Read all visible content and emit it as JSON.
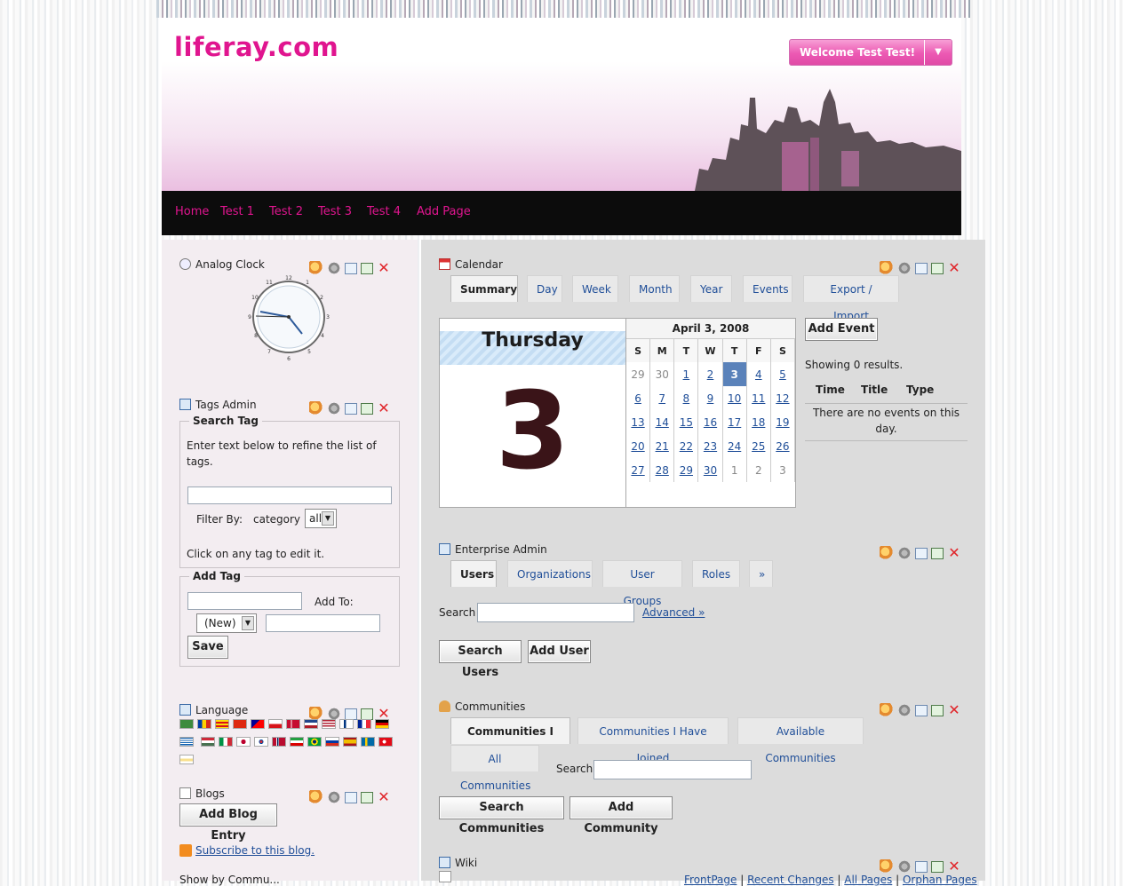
{
  "logo": "liferay.com",
  "welcome": "Welcome Test Test!",
  "nav": [
    "Home",
    "Test 1",
    "Test 2",
    "Test 3",
    "Test 4",
    "Add Page"
  ],
  "clock": {
    "title": "Analog Clock",
    "numerals": [
      "12",
      "1",
      "2",
      "3",
      "4",
      "5",
      "6",
      "7",
      "8",
      "9",
      "10",
      "11"
    ]
  },
  "tags_admin": {
    "title": "Tags Admin",
    "search_legend": "Search Tag",
    "instruction": "Enter text below to refine the list of tags.",
    "filter_label": "Filter By:",
    "filter_category": "category",
    "filter_value": "all",
    "click_hint": "Click on any tag to edit it.",
    "add_legend": "Add Tag",
    "add_to_label": "Add To:",
    "new_option": "(New)",
    "save": "Save"
  },
  "language": {
    "title": "Language"
  },
  "blogs": {
    "title": "Blogs",
    "add_entry": "Add Blog Entry",
    "subscribe": "Subscribe to this blog."
  },
  "partial_text": "Show by Commu...",
  "calendar": {
    "title": "Calendar",
    "tabs": [
      "Summary",
      "Day",
      "Week",
      "Month",
      "Year",
      "Events",
      "Export / Import"
    ],
    "day_name": "Thursday",
    "day_number": "3",
    "month_label": "April 3, 2008",
    "weekdays": [
      "S",
      "M",
      "T",
      "W",
      "T",
      "F",
      "S"
    ],
    "weeks": [
      [
        "29",
        "30",
        "1",
        "2",
        "3",
        "4",
        "5"
      ],
      [
        "6",
        "7",
        "8",
        "9",
        "10",
        "11",
        "12"
      ],
      [
        "13",
        "14",
        "15",
        "16",
        "17",
        "18",
        "19"
      ],
      [
        "20",
        "21",
        "22",
        "23",
        "24",
        "25",
        "26"
      ],
      [
        "27",
        "28",
        "29",
        "30",
        "1",
        "2",
        "3"
      ]
    ],
    "add_event": "Add Event",
    "results": "Showing 0 results.",
    "columns": [
      "Time",
      "Title",
      "Type"
    ],
    "empty": "There are no events on this day."
  },
  "enterprise": {
    "title": "Enterprise Admin",
    "tabs": [
      "Users",
      "Organizations",
      "User Groups",
      "Roles",
      "»"
    ],
    "search_label": "Search",
    "advanced": "Advanced »",
    "search_users": "Search Users",
    "add_user": "Add User"
  },
  "communities": {
    "title": "Communities",
    "tabs": [
      "Communities I Own",
      "Communities I Have Joined",
      "Available Communities",
      "All Communities"
    ],
    "search_label": "Search",
    "search_btn": "Search Communities",
    "add_btn": "Add Community"
  },
  "wiki": {
    "title": "Wiki",
    "links": [
      "FrontPage",
      "Recent Changes",
      "All Pages",
      "Orphan Pages"
    ]
  },
  "colors": {
    "brand_pink": "#e0158f",
    "nav_bg": "#0c0c0c",
    "today": "#5a82ba"
  }
}
